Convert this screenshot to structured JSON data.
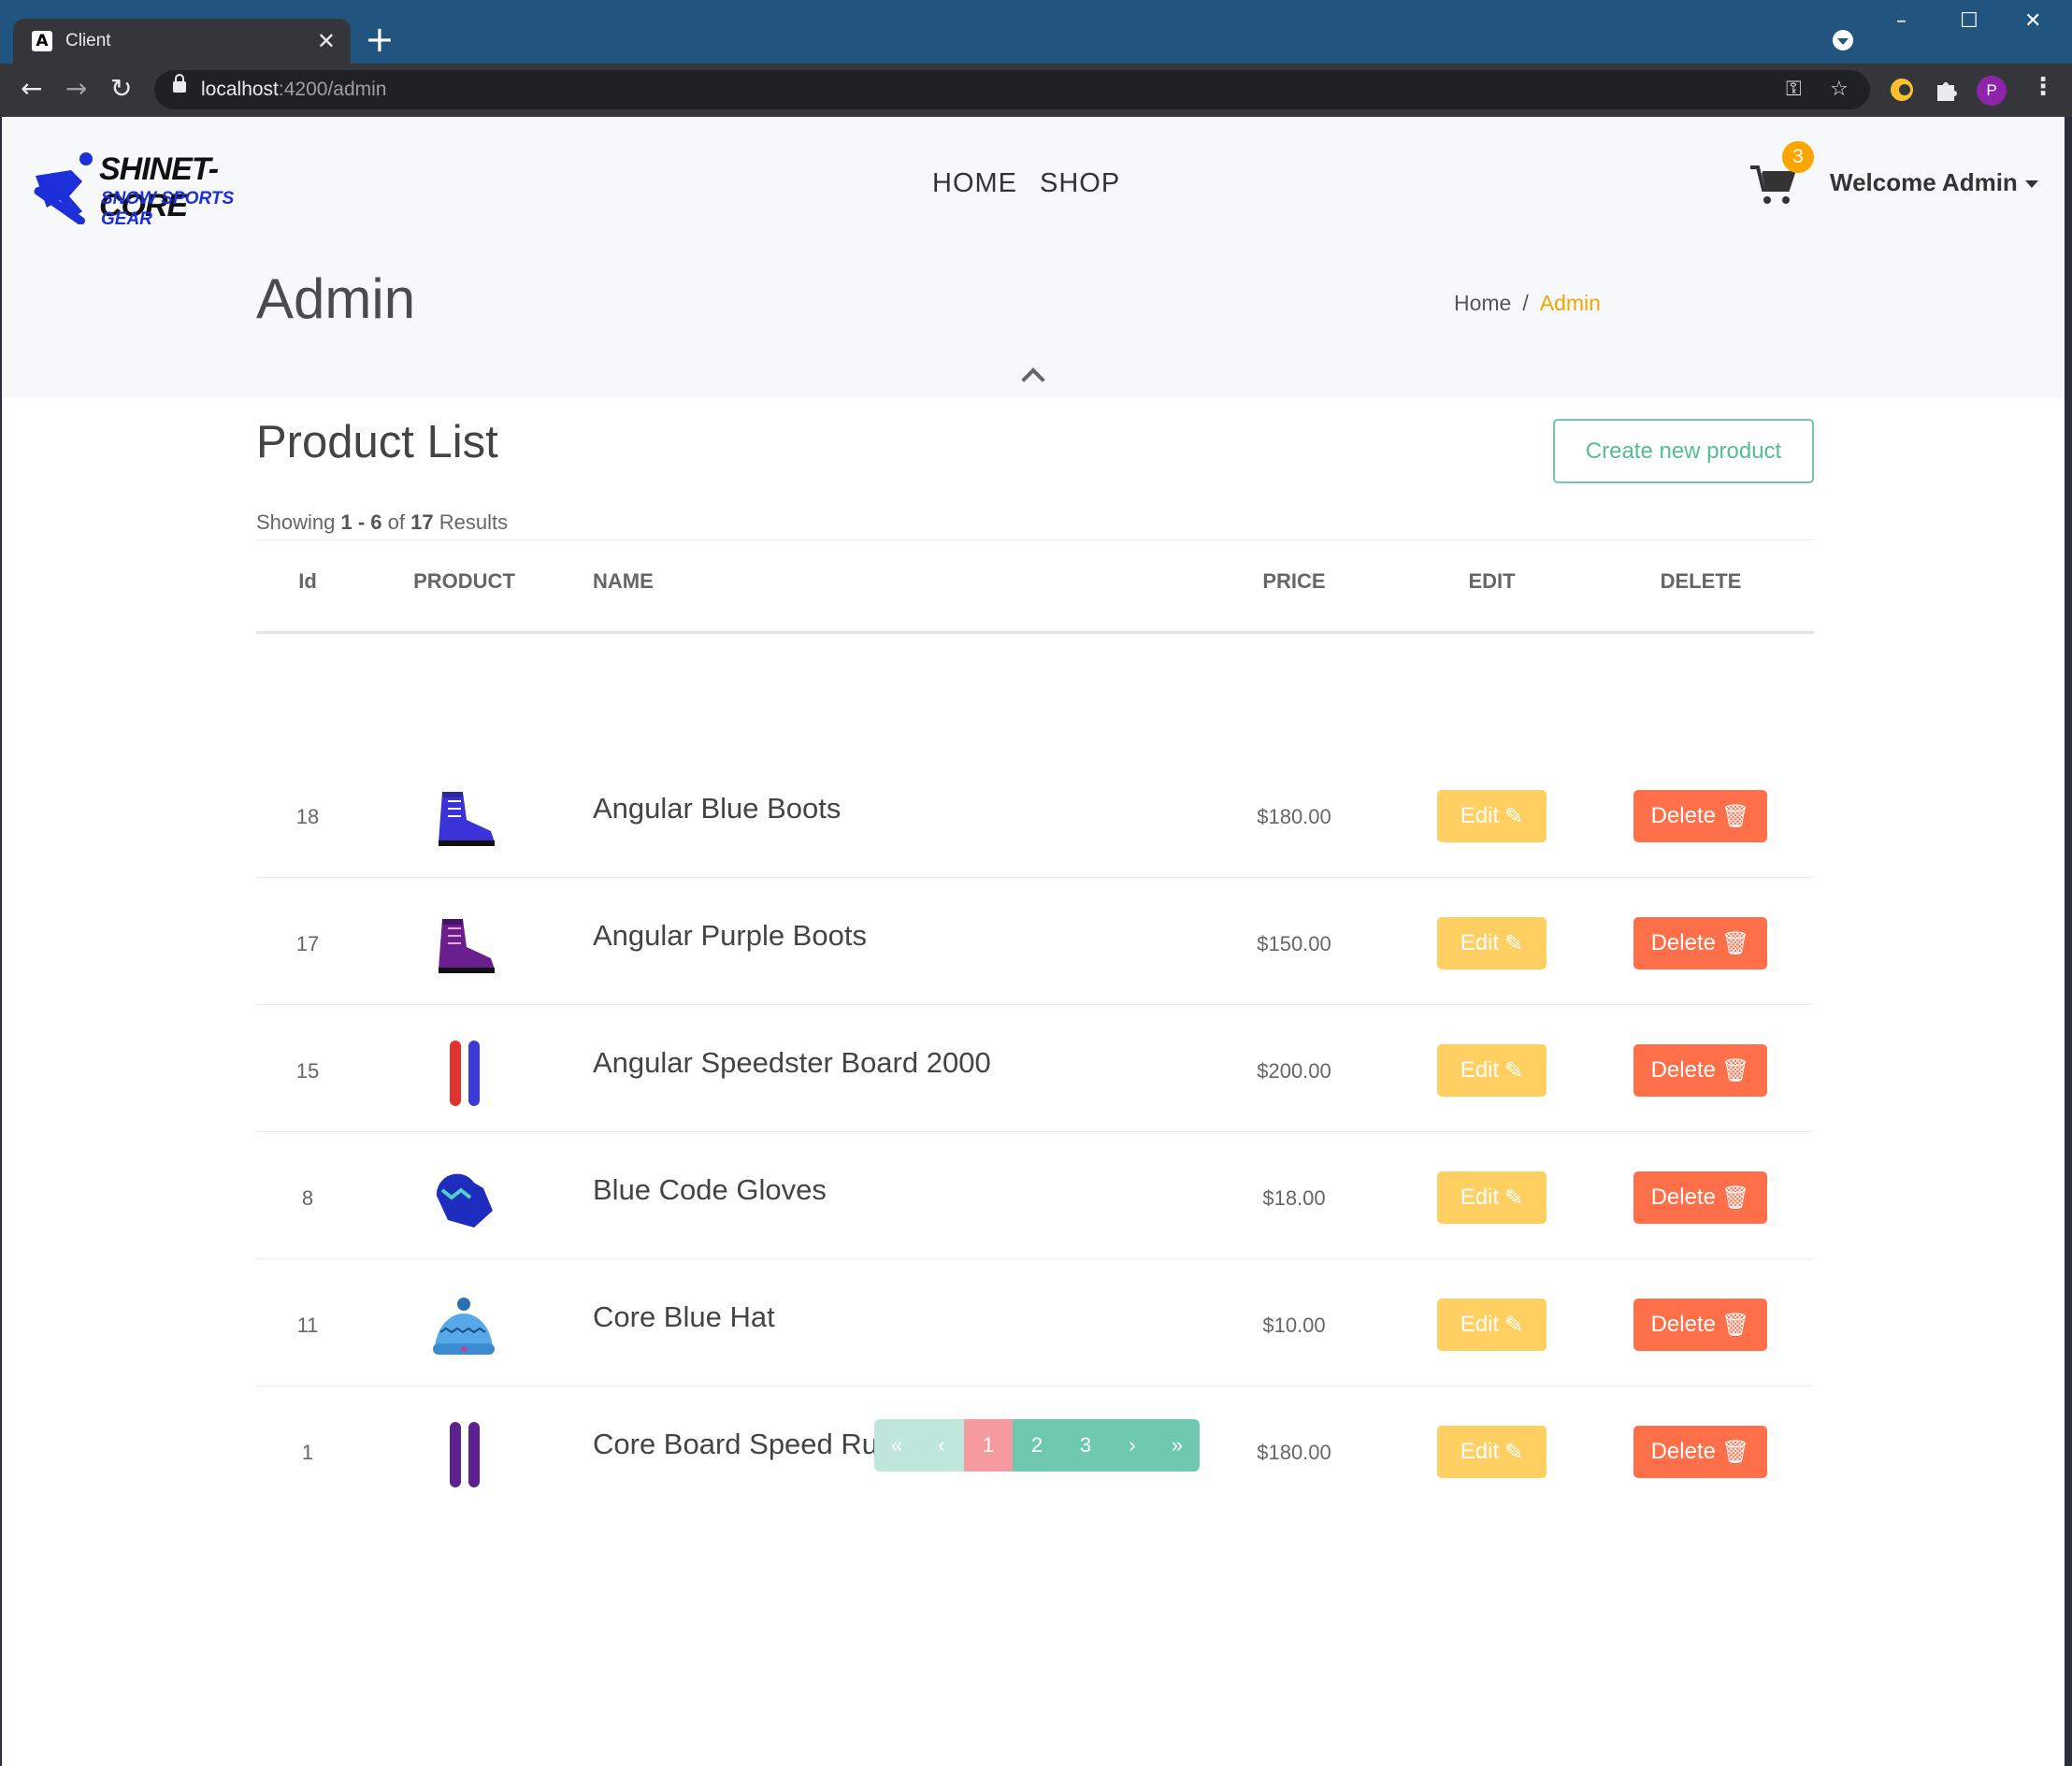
{
  "browser": {
    "tab_title": "Client",
    "tab_favicon": "A",
    "new_tab": "+",
    "url_host": "localhost",
    "url_path": ":4200/admin",
    "profile_initial": "P",
    "window_controls": {
      "minimize": "–",
      "maximize": "☐",
      "close": "✕"
    }
  },
  "site": {
    "logo_line1": "SHINET-CORE",
    "logo_line2": "SNOW SPORTS GEAR",
    "nav": {
      "home": "HOME",
      "shop": "SHOP"
    },
    "cart_count": "3",
    "welcome": "Welcome Admin"
  },
  "hero": {
    "title": "Admin",
    "breadcrumb": {
      "home": "Home",
      "separator": "/",
      "current": "Admin"
    }
  },
  "product_list": {
    "title": "Product List",
    "create_button": "Create new product",
    "results": {
      "prefix": "Showing",
      "range": "1 - 6",
      "of": "of",
      "total": "17",
      "suffix": "Results"
    },
    "columns": {
      "id": "Id",
      "product": "PRODUCT",
      "name": "NAME",
      "price": "PRICE",
      "edit": "EDIT",
      "delete": "DELETE"
    },
    "rows": [
      {
        "id": "18",
        "name": "Angular Blue Boots",
        "price": "$180.00",
        "image": "blue-boot-icon"
      },
      {
        "id": "17",
        "name": "Angular Purple Boots",
        "price": "$150.00",
        "image": "purple-boot-icon"
      },
      {
        "id": "15",
        "name": "Angular Speedster Board 2000",
        "price": "$200.00",
        "image": "red-blue-board-icon"
      },
      {
        "id": "8",
        "name": "Blue Code Gloves",
        "price": "$18.00",
        "image": "glove-icon"
      },
      {
        "id": "11",
        "name": "Core Blue Hat",
        "price": "$10.00",
        "image": "hat-icon"
      },
      {
        "id": "1",
        "name": "Core Board Speed Rush 3",
        "price": "$180.00",
        "image": "purple-board-icon"
      }
    ],
    "edit_label": "Edit",
    "delete_label": "Delete"
  },
  "pagination": {
    "first": "«",
    "prev": "‹",
    "pages": [
      "1",
      "2",
      "3"
    ],
    "current": "1",
    "next": "›",
    "last": "»"
  },
  "colors": {
    "edit": "#ffcf61",
    "delete": "#fe6f4a",
    "accent": "#f0a500",
    "pager": "#6fc9b0",
    "pager_current": "#f59aa0"
  }
}
